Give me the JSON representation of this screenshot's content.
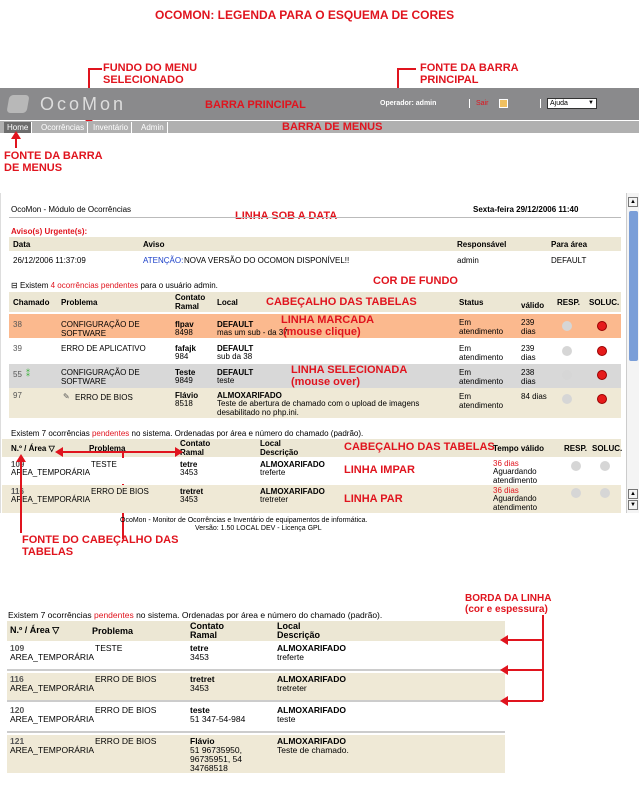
{
  "title": "OCOMON: LEGENDA PARA O ESQUEMA DE CORES",
  "annotations": {
    "fundo_menu": "FUNDO DO MENU\nSELECIONADO",
    "fonte_barra_principal": "FONTE DA BARRA\nPRINCIPAL",
    "barra_principal": "BARRA PRINCIPAL",
    "barra_menus": "BARRA DE MENUS",
    "fonte_barra_menus": "FONTE DA BARRA\nDE MENUS",
    "linha_sob_data": "LINHA SOB A DATA",
    "cor_fundo": "COR DE FUNDO",
    "cabecalho_tabelas_1": "CABEÇALHO DAS TABELAS",
    "linha_marcada": "LINHA MARCADA",
    "linha_marcada_sub": "(mouse clique)",
    "linha_selecionada": "LINHA SELECIONADA",
    "linha_selecionada_sub": "(mouse over)",
    "cabecalho_tabelas_2": "CABEÇALHO DAS TABELAS",
    "linha_impar": "LINHA IMPAR",
    "linha_par": "LINHA PAR",
    "fonte_cabecalho": "FONTE DO CABEÇALHO DAS\nTABELAS",
    "borda_linha": "BORDA DA LINHA\n(cor e espessura)"
  },
  "topbar": {
    "logo": "OcoMon",
    "operador": "Operador: admin",
    "sair": "Sair",
    "ajuda": "Ajuda"
  },
  "menu": [
    "Home",
    "Ocorrências",
    "Inventário",
    "Admin"
  ],
  "header": {
    "module": "OcoMon - Módulo de Ocorrências",
    "date": "Sexta-feira 29/12/2006 11:40"
  },
  "avisos": {
    "title": "Aviso(s) Urgente(s):",
    "cols": [
      "Data",
      "Aviso",
      "Responsável",
      "Para área"
    ],
    "row": {
      "data": "26/12/2006 11:37:09",
      "aviso_label": "ATENÇÃO:",
      "aviso": "NOVA VERSÃO DO OCOMON DISPONÍVEL!!",
      "resp": "admin",
      "area": "DEFAULT"
    }
  },
  "pendentes_user": {
    "pre": "Existem",
    "count": "4 ocorrências pendentes",
    "post": "para o usuário admin.",
    "cols": [
      "Chamado",
      "Problema",
      "Contato\nRamal",
      "Local",
      "Status",
      "válido",
      "RESP.",
      "SOLUC."
    ],
    "rows": [
      {
        "id": "38",
        "prob": "CONFIGURAÇÃO DE\nSOFTWARE",
        "contato": "flpav",
        "ramal": "8498",
        "local": "DEFAULT",
        "desc": "mas um sub - da 37",
        "status": "Em\natendimento",
        "valido": "239\ndias"
      },
      {
        "id": "39",
        "prob": "ERRO DE APLICATIVO",
        "contato": "fafajk",
        "ramal": "984",
        "local": "DEFAULT",
        "desc": "sub da 38",
        "status": "Em\natendimento",
        "valido": "239\ndias"
      },
      {
        "id": "55",
        "prob": "CONFIGURAÇÃO DE\nSOFTWARE",
        "contato": "Teste",
        "ramal": "9849",
        "local": "DEFAULT",
        "desc": "teste",
        "status": "Em\natendimento",
        "valido": "238\ndias"
      },
      {
        "id": "97",
        "prob": "ERRO DE BIOS",
        "contato": "Flávio",
        "ramal": "8518",
        "local": "ALMOXARIFADO",
        "desc": "Teste de abertura de chamado com o upload de imagens\ndesabilitado no php.ini.",
        "status": "Em\natendimento",
        "valido": "84 dias"
      }
    ]
  },
  "pendentes_sistema": {
    "pre": "Existem 7 ocorrências",
    "word": "pendentes",
    "post": "no sistema. Ordenadas por área e número do chamado (padrão).",
    "cols": [
      "N.º / Área ▽",
      "Problema",
      "Contato\nRamal",
      "Local\nDescrição",
      "Tempo válido",
      "RESP.",
      "SOLUC."
    ],
    "rows": [
      {
        "id": "109",
        "area": "AREA_TEMPORÁRIA",
        "prob": "TESTE",
        "contato": "tetre",
        "ramal": "3453",
        "local": "ALMOXARIFADO",
        "desc": "treferte",
        "tempo": "36 dias",
        "tempo2": "Aguardando\natendimento"
      },
      {
        "id": "116",
        "area": "AREA_TEMPORÁRIA",
        "prob": "ERRO DE BIOS",
        "contato": "tretret",
        "ramal": "3453",
        "local": "ALMOXARIFADO",
        "desc": "tretreter",
        "tempo": "36 dias",
        "tempo2": "Aguardando\natendimento"
      }
    ]
  },
  "footer": {
    "line1": "OcoMon - Monitor de Ocorrências e Inventário de equipamentos de informática.",
    "line2": "Versão: 1.50 LOCAL DEV - Licença GPL"
  },
  "bottom_table": {
    "pre": "Existem 7 ocorrências",
    "word": "pendentes",
    "post": "no sistema. Ordenadas por área e número do chamado (padrão).",
    "cols": [
      "N.º / Área ▽",
      "Problema",
      "Contato\nRamal",
      "Local\nDescrição"
    ],
    "rows": [
      {
        "id": "109",
        "area": "AREA_TEMPORÁRIA",
        "prob": "TESTE",
        "contato": "tetre",
        "ramal": "3453",
        "local": "ALMOXARIFADO",
        "desc": "treferte"
      },
      {
        "id": "116",
        "area": "AREA_TEMPORÁRIA",
        "prob": "ERRO DE BIOS",
        "contato": "tretret",
        "ramal": "3453",
        "local": "ALMOXARIFADO",
        "desc": "tretreter"
      },
      {
        "id": "120",
        "area": "AREA_TEMPORÁRIA",
        "prob": "ERRO DE BIOS",
        "contato": "teste",
        "ramal": "51 347-54-984",
        "local": "ALMOXARIFADO",
        "desc": "teste"
      },
      {
        "id": "121",
        "area": "AREA_TEMPORÁRIA",
        "prob": "ERRO DE BIOS",
        "contato": "Flávio",
        "ramal": "51 96735950,\n96735951, 54\n34768518",
        "local": "ALMOXARIFADO",
        "desc": "Teste de chamado."
      }
    ]
  },
  "colors": {
    "annotation": "#e0141e",
    "hdr": "#ece7d4",
    "marked": "#fbb98e",
    "hover": "#d8d8d8",
    "even": "#efe9d6"
  }
}
